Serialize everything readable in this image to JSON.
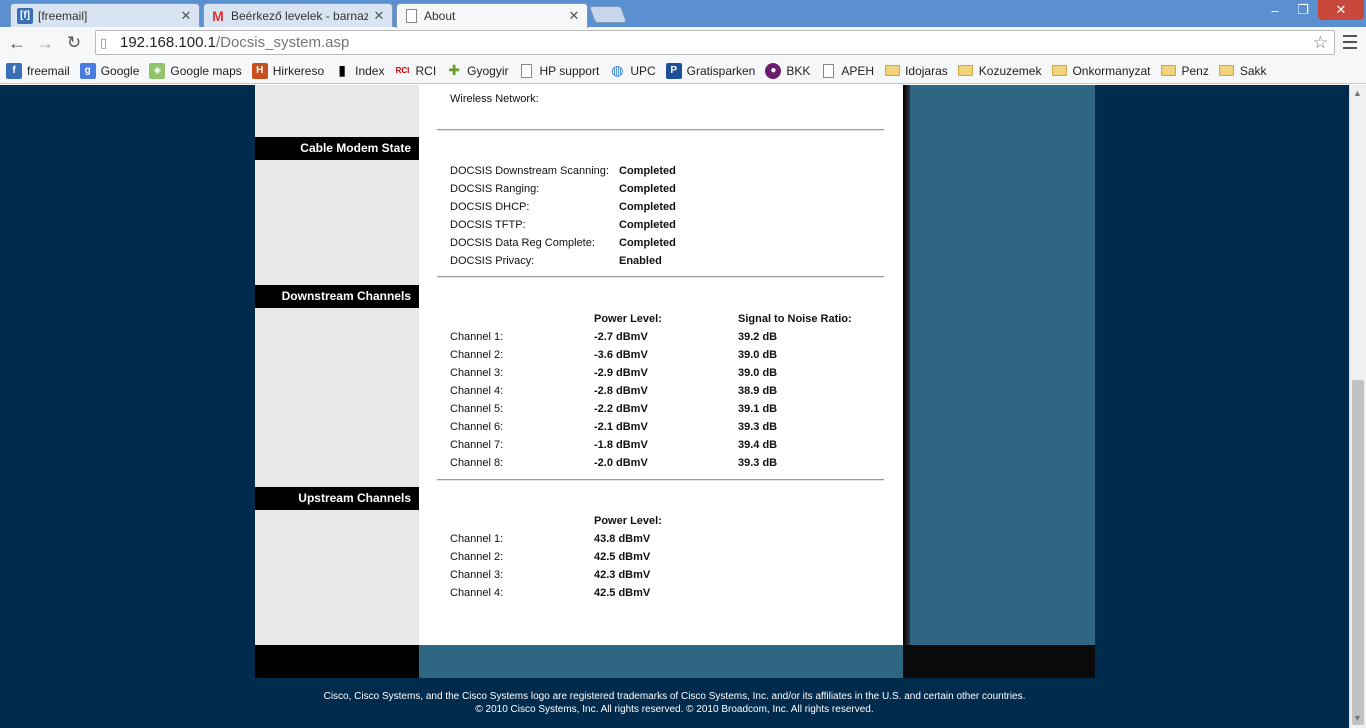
{
  "tabs": [
    {
      "title": "[freemail]",
      "icon": "freemail-icon",
      "active": false
    },
    {
      "title": "Beérkező levelek - barnazs",
      "icon": "gmail-icon",
      "active": false
    },
    {
      "title": "About",
      "icon": "page-icon",
      "active": true
    }
  ],
  "toolbar": {
    "url_host": "192.168.100.1",
    "url_path": "/Docsis_system.asp"
  },
  "bookmarks": [
    {
      "label": "freemail",
      "icon": "freemail-icon"
    },
    {
      "label": "Google",
      "icon": "google-icon"
    },
    {
      "label": "Google maps",
      "icon": "maps-icon"
    },
    {
      "label": "Hirkereso",
      "icon": "hirkereso-icon"
    },
    {
      "label": "Index",
      "icon": "index-icon"
    },
    {
      "label": "RCI",
      "icon": "rci-icon"
    },
    {
      "label": "Gyogyir",
      "icon": "gyogyir-icon"
    },
    {
      "label": "HP support",
      "icon": "page-icon"
    },
    {
      "label": "UPC",
      "icon": "upc-icon"
    },
    {
      "label": "Gratisparken",
      "icon": "parking-icon"
    },
    {
      "label": "BKK",
      "icon": "bkk-icon"
    },
    {
      "label": "APEH",
      "icon": "page-icon"
    },
    {
      "label": "Idojaras",
      "icon": "folder-icon"
    },
    {
      "label": "Kozuzemek",
      "icon": "folder-icon"
    },
    {
      "label": "Onkormanyzat",
      "icon": "folder-icon"
    },
    {
      "label": "Penz",
      "icon": "folder-icon"
    },
    {
      "label": "Sakk",
      "icon": "folder-icon"
    }
  ],
  "page": {
    "wireless_label": "Wireless Network:",
    "cable_modem": {
      "heading": "Cable Modem State",
      "rows": [
        {
          "label": "DOCSIS Downstream Scanning:",
          "value": "Completed"
        },
        {
          "label": "DOCSIS Ranging:",
          "value": "Completed"
        },
        {
          "label": "DOCSIS DHCP:",
          "value": "Completed"
        },
        {
          "label": "DOCSIS TFTP:",
          "value": "Completed"
        },
        {
          "label": "DOCSIS Data Reg Complete:",
          "value": "Completed"
        },
        {
          "label": "DOCSIS Privacy:",
          "value": "Enabled"
        }
      ]
    },
    "downstream": {
      "heading": "Downstream Channels",
      "col_power": "Power Level:",
      "col_snr": "Signal to Noise Ratio:",
      "rows": [
        {
          "channel": "Channel 1:",
          "power": "-2.7 dBmV",
          "snr": "39.2 dB"
        },
        {
          "channel": "Channel 2:",
          "power": "-3.6 dBmV",
          "snr": "39.0 dB"
        },
        {
          "channel": "Channel 3:",
          "power": "-2.9 dBmV",
          "snr": "39.0 dB"
        },
        {
          "channel": "Channel 4:",
          "power": "-2.8 dBmV",
          "snr": "38.9 dB"
        },
        {
          "channel": "Channel 5:",
          "power": "-2.2 dBmV",
          "snr": "39.1 dB"
        },
        {
          "channel": "Channel 6:",
          "power": "-2.1 dBmV",
          "snr": "39.3 dB"
        },
        {
          "channel": "Channel 7:",
          "power": "-1.8 dBmV",
          "snr": "39.4 dB"
        },
        {
          "channel": "Channel 8:",
          "power": "-2.0 dBmV",
          "snr": "39.3 dB"
        }
      ]
    },
    "upstream": {
      "heading": "Upstream Channels",
      "col_power": "Power Level:",
      "rows": [
        {
          "channel": "Channel 1:",
          "power": "43.8 dBmV"
        },
        {
          "channel": "Channel 2:",
          "power": "42.5 dBmV"
        },
        {
          "channel": "Channel 3:",
          "power": "42.3 dBmV"
        },
        {
          "channel": "Channel 4:",
          "power": "42.5 dBmV"
        }
      ]
    },
    "footer_line1": "Cisco, Cisco Systems, and the Cisco Systems logo are registered trademarks of Cisco Systems, Inc. and/or its affiliates in the U.S. and certain other countries.",
    "footer_line2": "© 2010 Cisco Systems, Inc. All rights reserved. © 2010 Broadcom, Inc. All rights reserved."
  }
}
